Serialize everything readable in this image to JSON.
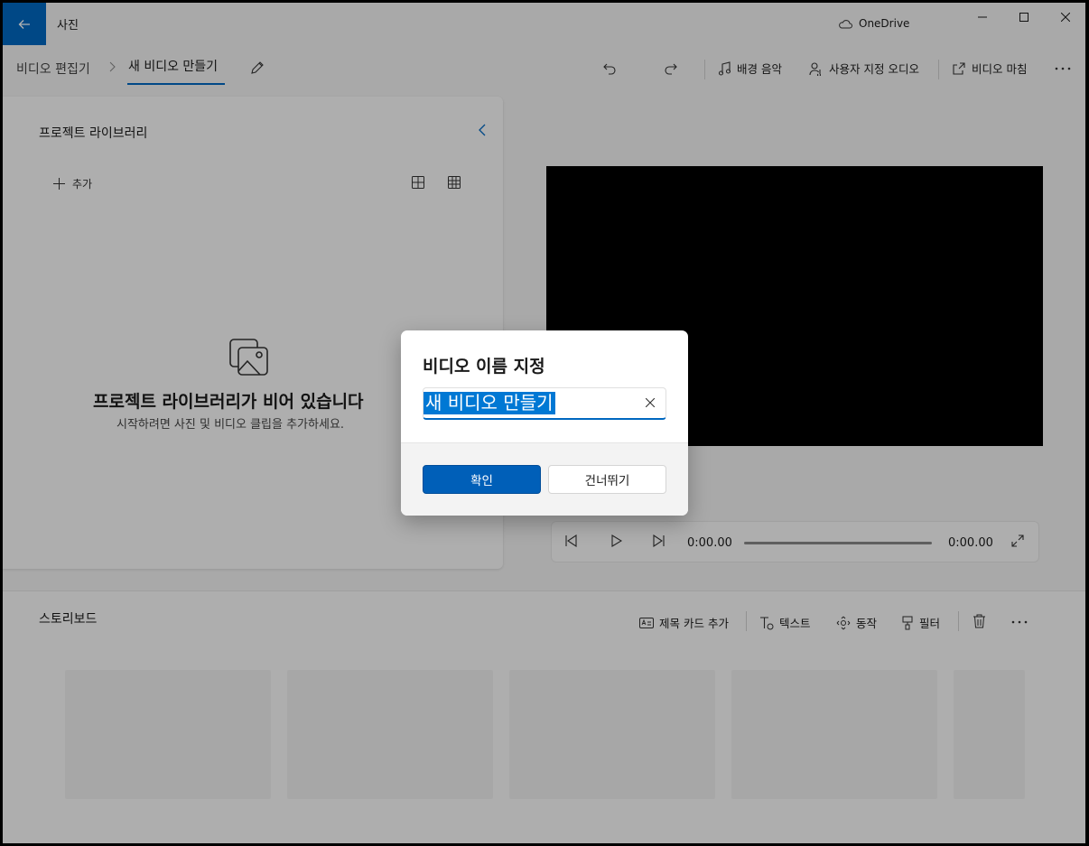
{
  "app": {
    "title": "사진",
    "onedrive_label": "OneDrive",
    "back_icon": "back-arrow-icon"
  },
  "breadcrumb": {
    "root": "비디오 편집기",
    "current": "새 비디오 만들기"
  },
  "toolbar": {
    "background_music": "배경 음악",
    "custom_audio": "사용자 지정 오디오",
    "finish_video": "비디오 마침"
  },
  "library": {
    "title": "프로젝트 라이브러리",
    "add_label": "추가",
    "empty_title": "프로젝트 라이브러리가 비어 있습니다",
    "empty_subtitle": "시작하려면 사진 및 비디오 클립을 추가하세요."
  },
  "player": {
    "current_time": "0:00.00",
    "total_time": "0:00.00",
    "progress": 0
  },
  "storyboard": {
    "title": "스토리보드",
    "add_title_card": "제목 카드 추가",
    "text": "텍스트",
    "motion": "동작",
    "filters": "필터"
  },
  "dialog": {
    "title": "비디오 이름 지정",
    "input_value": "새 비디오 만들기",
    "confirm_label": "확인",
    "skip_label": "건너뛰기"
  },
  "colors": {
    "accent": "#0067c0",
    "primary_button": "#005fb8",
    "selection": "#0078d4"
  }
}
